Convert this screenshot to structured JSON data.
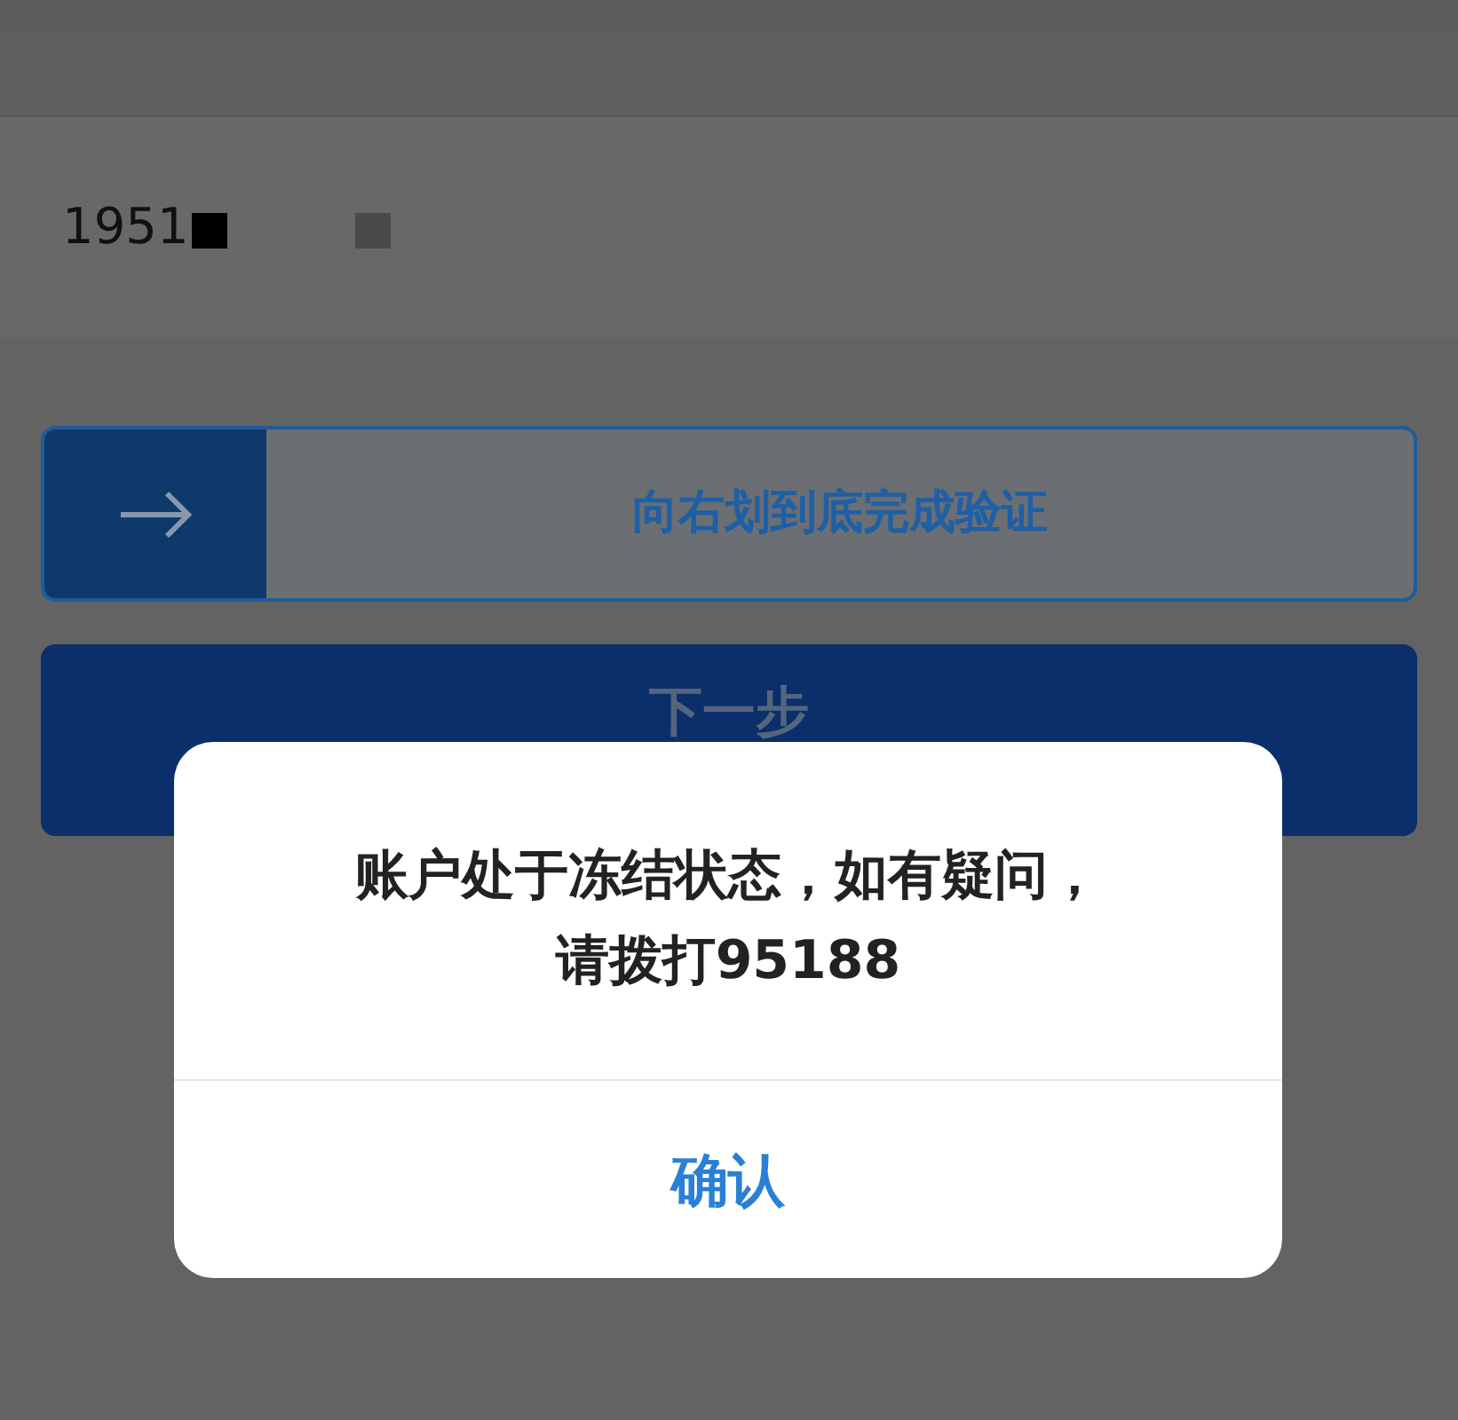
{
  "phone_field": {
    "value": "1951"
  },
  "slider": {
    "label": "向右划到底完成验证",
    "level": 0
  },
  "next_button": {
    "label": "下一步"
  },
  "dialog": {
    "message": "账户处于冻结状态，如有疑问，请拨打95188",
    "buttons": [
      "确认"
    ]
  }
}
